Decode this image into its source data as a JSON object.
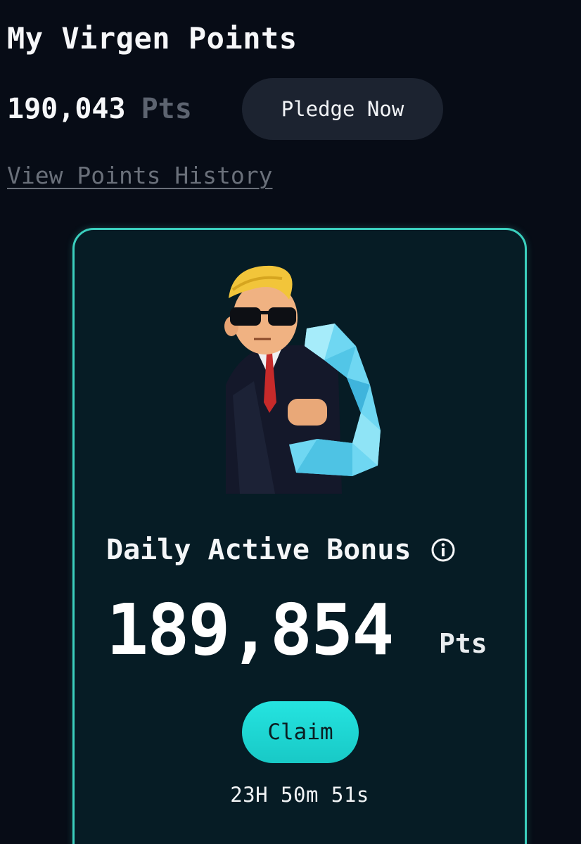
{
  "header": {
    "title": "My Virgen Points"
  },
  "balance": {
    "value": "190,043",
    "unit": "Pts"
  },
  "pledge_button": {
    "label": "Pledge Now"
  },
  "history_link": {
    "label": "View Points History"
  },
  "bonus_card": {
    "mascot_icon": "muscle-mascot-icon",
    "title": "Daily Active Bonus",
    "info_icon": "info-icon",
    "amount": "189,854",
    "unit": "Pts",
    "claim_label": "Claim",
    "countdown": "23H 50m 51s"
  },
  "colors": {
    "background": "#070c16",
    "card_border": "#3bcfbe",
    "card_background": "#061c25",
    "claim_button": "#1fd6d3",
    "pledge_button": "#1c2330",
    "muted_text": "#5d6470"
  }
}
